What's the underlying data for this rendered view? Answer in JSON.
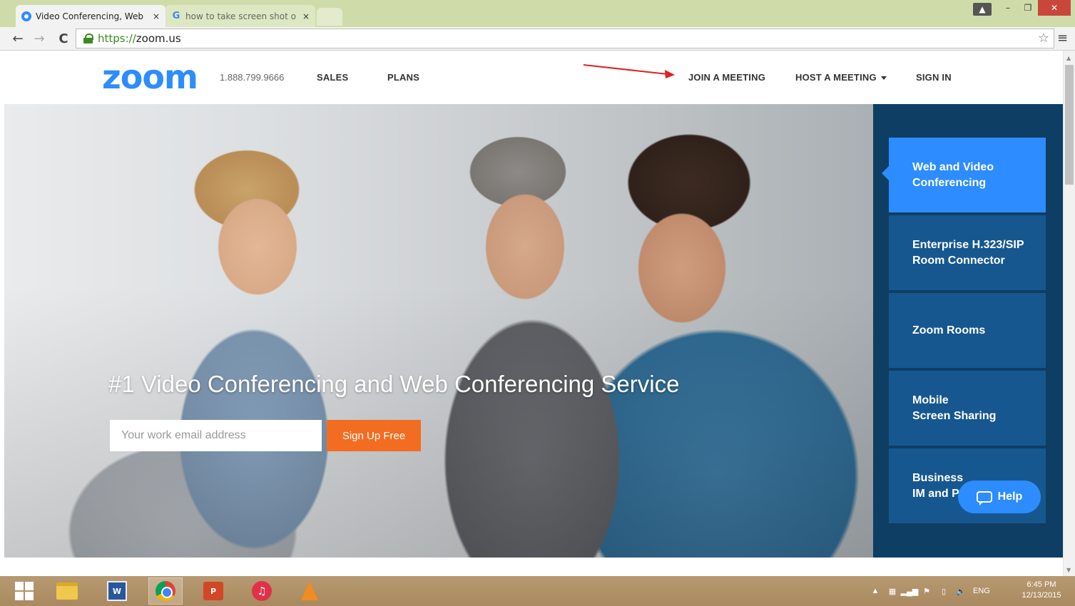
{
  "browser": {
    "tabs": [
      {
        "title": "Video Conferencing, Web",
        "active": true
      },
      {
        "title": "how to take screen shot o",
        "active": false
      }
    ],
    "tab_close": "×",
    "url_scheme": "https://",
    "url_host": "zoom.us"
  },
  "header": {
    "logo": "zoom",
    "phone": "1.888.799.9666",
    "nav": {
      "sales": "SALES",
      "plans": "PLANS",
      "join": "JOIN A MEETING",
      "host": "HOST A MEETING",
      "signin": "SIGN IN"
    }
  },
  "hero": {
    "title": "#1 Video Conferencing and Web Conferencing Service",
    "email_placeholder": "Your work email address",
    "signup_label": "Sign Up Free"
  },
  "side_menu": [
    {
      "label": "Web and Video\nConferencing",
      "active": true
    },
    {
      "label": "Enterprise H.323/SIP\nRoom Connector",
      "active": false
    },
    {
      "label": "Zoom Rooms",
      "active": false
    },
    {
      "label": "Mobile\nScreen Sharing",
      "active": false
    },
    {
      "label": "Business\nIM and Presence",
      "active": false
    }
  ],
  "help_label": "Help",
  "taskbar": {
    "lang": "ENG",
    "time": "6:45 PM",
    "date": "12/13/2015"
  },
  "colors": {
    "brand_blue": "#2d8cff",
    "signup_orange": "#f26d21",
    "side_panel": "#0e3e63",
    "annotation_arrow": "#e02020"
  },
  "icons": [
    "back-arrow-icon",
    "forward-arrow-icon",
    "reload-icon",
    "lock-icon",
    "star-icon",
    "menu-icon",
    "chat-icon",
    "windows-start-icon"
  ]
}
